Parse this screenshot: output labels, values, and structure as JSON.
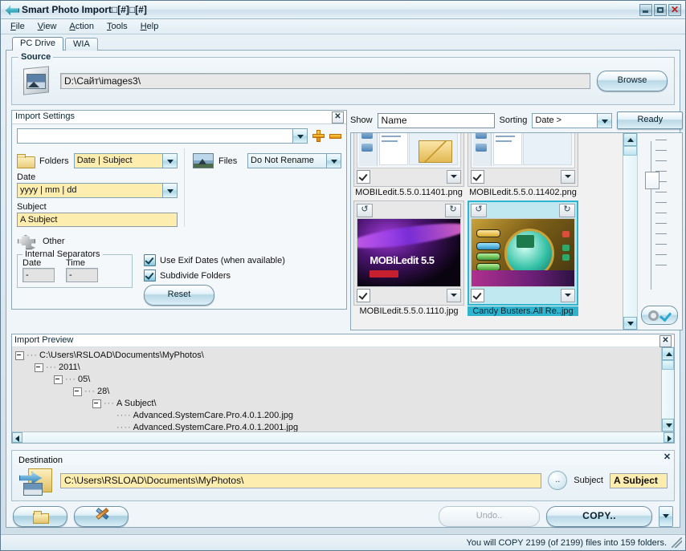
{
  "window": {
    "title": "Smart Photo Import□[#]□[#]",
    "icon": "import-arrow-icon",
    "buttons": {
      "minimize": "minimize-icon",
      "maximize": "maximize-icon",
      "close": "close-icon"
    }
  },
  "menu": [
    {
      "label": "File",
      "accel": "F"
    },
    {
      "label": "View",
      "accel": "V"
    },
    {
      "label": "Action",
      "accel": "A"
    },
    {
      "label": "Tools",
      "accel": "T"
    },
    {
      "label": "Help",
      "accel": "H"
    }
  ],
  "tabs": [
    {
      "label": "PC Drive",
      "active": true
    },
    {
      "label": "WIA",
      "active": false
    }
  ],
  "source": {
    "legend": "Source",
    "path": "D:\\Сайт\\images3\\",
    "browse_label": "Browse"
  },
  "import_settings": {
    "title": "Import Settings",
    "close": "✕",
    "preset_value": "",
    "add_label": "+",
    "remove_label": "−",
    "folders_label": "Folders",
    "folders_value": "Date | Subject",
    "date_label": "Date",
    "date_value": "yyyy | mm | dd",
    "subject_label": "Subject",
    "subject_value": "A Subject",
    "files_label": "Files",
    "files_value": "Do Not Rename",
    "other_label": "Other",
    "separators_legend": "Internal Separators",
    "sep_date_label": "Date",
    "sep_date_value": "-",
    "sep_time_label": "Time",
    "sep_time_value": "-",
    "exif_label": "Use Exif Dates (when available)",
    "exif_checked": true,
    "subdivide_label": "Subdivide Folders",
    "subdivide_checked": true,
    "reset_label": "Reset"
  },
  "thumbnails": {
    "show_label": "Show",
    "show_value": "Name",
    "sorting_label": "Sorting",
    "sorting_value": "Date >",
    "ready_label": "Ready",
    "items": [
      {
        "name": "MOBILedit.5.5.0.11401.png",
        "checked": true,
        "selected": false,
        "art": "screenshot-blue"
      },
      {
        "name": "MOBILedit.5.5.0.11402.png",
        "checked": true,
        "selected": false,
        "art": "screenshot-green"
      },
      {
        "name": "MOBILedit.5.5.0.1110.jpg",
        "checked": true,
        "selected": false,
        "art": "mobiledit-splash"
      },
      {
        "name": "Candy Busters.All Re..jpg",
        "checked": true,
        "selected": true,
        "art": "candy-busters"
      }
    ],
    "rotate_left_icon": "rotate-ccw-icon",
    "rotate_right_icon": "rotate-cw-icon"
  },
  "import_preview": {
    "title": "Import Preview",
    "close": "✕",
    "tree": [
      {
        "depth": 0,
        "label": "C:\\Users\\RSLOAD\\Documents\\MyPhotos\\",
        "type": "folder"
      },
      {
        "depth": 1,
        "label": "2011\\",
        "type": "folder"
      },
      {
        "depth": 2,
        "label": "05\\",
        "type": "folder"
      },
      {
        "depth": 3,
        "label": "28\\",
        "type": "folder"
      },
      {
        "depth": 4,
        "label": "A Subject\\",
        "type": "folder"
      },
      {
        "depth": 5,
        "label": "Advanced.SystemCare.Pro.4.0.1.200.jpg",
        "type": "file"
      },
      {
        "depth": 5,
        "label": "Advanced.SystemCare.Pro.4.0.1.2001.jpg",
        "type": "file"
      }
    ]
  },
  "destination": {
    "legend": "Destination",
    "path": "C:\\Users\\RSLOAD\\Documents\\MyPhotos\\",
    "dots_label": "..",
    "subject_label": "Subject",
    "subject_value": "A Subject",
    "close": "✕"
  },
  "actions": {
    "open_folder_icon": "folder-open-icon",
    "tools_icon": "tools-icon",
    "undo_label": "Undo..",
    "undo_disabled": true,
    "copy_label": "COPY..",
    "copy_menu_icon": "chevron-down-icon"
  },
  "status": {
    "text": "You will COPY 2199 (of 2199) files into 159 folders.",
    "grip": "resize-grip-icon"
  },
  "colors": {
    "accent": "#2fb4cf",
    "yellow_field": "#fdeeb0",
    "frame": "#8aa8b8"
  }
}
